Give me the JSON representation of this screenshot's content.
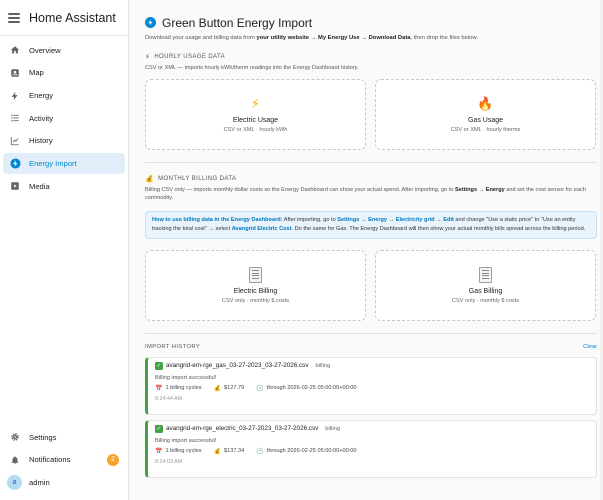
{
  "sidebar": {
    "title": "Home Assistant",
    "items": [
      {
        "label": "Overview",
        "icon": "view-dashboard-icon"
      },
      {
        "label": "Map",
        "icon": "map-icon"
      },
      {
        "label": "Energy",
        "icon": "lightning-icon"
      },
      {
        "label": "Activity",
        "icon": "list-icon"
      },
      {
        "label": "History",
        "icon": "chart-icon"
      },
      {
        "label": "Energy Import",
        "icon": "lightning-circle-icon",
        "active": true
      },
      {
        "label": "Media",
        "icon": "play-box-icon"
      }
    ],
    "bottom": {
      "settings": "Settings",
      "notifications": "Notifications",
      "notifications_count": "2",
      "user": "admin",
      "avatar_letter": "a"
    }
  },
  "page": {
    "title": "Green Button Energy Import",
    "subtitle_pre": "Download your usage and billing data from ",
    "subtitle_bold": "your utility website → My Energy Use → Download Data",
    "subtitle_post": ", then drop the files below."
  },
  "hourly": {
    "heading": "HOURLY USAGE DATA",
    "desc": "CSV or XML — imports hourly kWh/therm readings into the Energy Dashboard history.",
    "cards": [
      {
        "title": "Electric Usage",
        "sub": "CSV or XML · hourly kWh",
        "icon": "⚡"
      },
      {
        "title": "Gas Usage",
        "sub": "CSV or XML · hourly therms",
        "icon": "🔥"
      }
    ]
  },
  "billing": {
    "heading": "MONTHLY BILLING DATA",
    "desc_1": "Billing CSV only — imports monthly dollar costs so the Energy Dashboard can show your actual spend. After importing, go to ",
    "desc_b1": "Settings",
    "desc_2": " → ",
    "desc_b2": "Energy",
    "desc_3": " and set the cost sensor for each commodity.",
    "info": {
      "p1": "How to use billing data in the Energy Dashboard:",
      "p2": " After importing, go to ",
      "p3": "Settings",
      "p4": " → ",
      "p5": "Energy",
      "p6": " → ",
      "p7": "Electricity grid",
      "p8": " → ",
      "p9": "Edit",
      "p10": " and change \"Use a static price\" to \"Use an entity tracking the total cost\" → select ",
      "p11": "Avangrid Electric Cost",
      "p12": ". Do the same for Gas. The Energy Dashboard will then show your actual monthly bills spread across the billing period."
    },
    "cards": [
      {
        "title": "Electric Billing",
        "sub": "CSV only · monthly $ costs"
      },
      {
        "title": "Gas Billing",
        "sub": "CSV only · monthly $ costs"
      }
    ]
  },
  "history": {
    "heading": "IMPORT HISTORY",
    "clear": "Clear",
    "entries": [
      {
        "file": "avangrid-em-rge_gas_03-27-2023_03-27-2026.csv",
        "tag": "billing",
        "msg": "Billing import successful!",
        "cycles": "1 billing cycles",
        "amount": "$127.79",
        "through": "through 2026-02-25 05:00:00+00:00",
        "time": "8:24:44 AM"
      },
      {
        "file": "avangrid-em-rge_electric_03-27-2023_03-27-2026.csv",
        "tag": "billing",
        "msg": "Billing import successful!",
        "cycles": "1 billing cycles",
        "amount": "$137.34",
        "through": "through 2026-02-25 05:00:00+00:00",
        "time": "8:24:03 AM"
      }
    ]
  },
  "colors": {
    "accent": "#0288d1",
    "success": "#43a047",
    "badge": "#f5a22c"
  }
}
